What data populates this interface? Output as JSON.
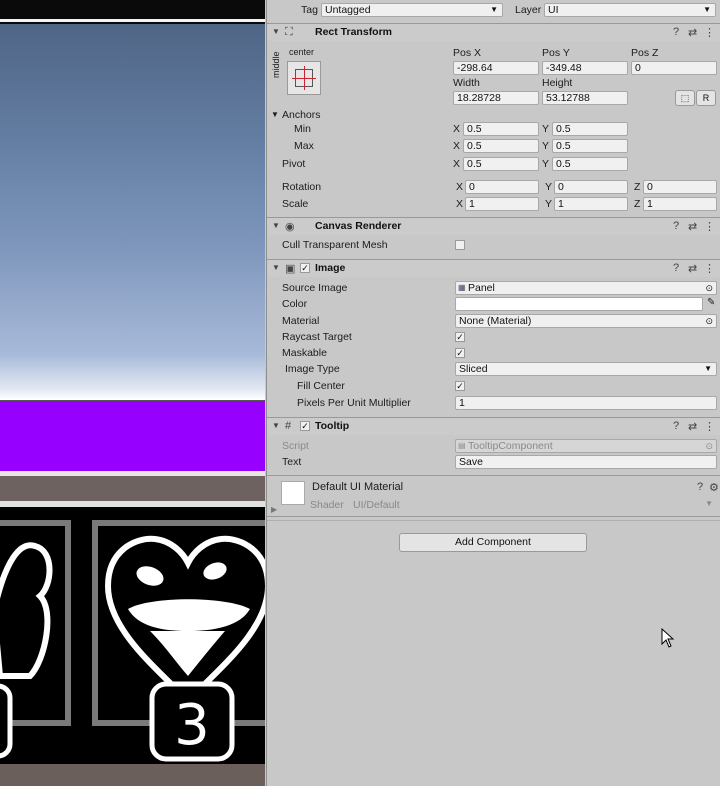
{
  "top": {
    "tag_label": "Tag",
    "tag_value": "Untagged",
    "layer_label": "Layer",
    "layer_value": "UI"
  },
  "rect_transform": {
    "title": "Rect Transform",
    "anchor_preset_top": "center",
    "anchor_preset_side": "middle",
    "pos_x_label": "Pos X",
    "pos_y_label": "Pos Y",
    "pos_z_label": "Pos Z",
    "pos_x": "-298.64",
    "pos_y": "-349.48",
    "pos_z": "0",
    "width_label": "Width",
    "height_label": "Height",
    "width": "18.28728",
    "height": "53.12788",
    "raw_edit_btn": "R",
    "anchors_label": "Anchors",
    "min_label": "Min",
    "max_label": "Max",
    "min_x": "0.5",
    "min_y": "0.5",
    "max_x": "0.5",
    "max_y": "0.5",
    "pivot_label": "Pivot",
    "pivot_x": "0.5",
    "pivot_y": "0.5",
    "rotation_label": "Rotation",
    "rot_x": "0",
    "rot_y": "0",
    "rot_z": "0",
    "scale_label": "Scale",
    "scale_x": "1",
    "scale_y": "1",
    "scale_z": "1",
    "axis_x": "X",
    "axis_y": "Y",
    "axis_z": "Z"
  },
  "canvas_renderer": {
    "title": "Canvas Renderer",
    "cull_label": "Cull Transparent Mesh"
  },
  "image": {
    "title": "Image",
    "source_image_label": "Source Image",
    "source_image_value": "Panel",
    "color_label": "Color",
    "material_label": "Material",
    "material_value": "None (Material)",
    "raycast_label": "Raycast Target",
    "maskable_label": "Maskable",
    "image_type_label": "Image Type",
    "image_type_value": "Sliced",
    "fill_center_label": "Fill Center",
    "ppu_label": "Pixels Per Unit Multiplier",
    "ppu_value": "1"
  },
  "tooltip": {
    "title": "Tooltip",
    "script_label": "Script",
    "script_value": "TooltipComponent",
    "text_label": "Text",
    "text_value": "Save"
  },
  "material_preview": {
    "title": "Default UI Material",
    "shader_label": "Shader",
    "shader_value": "UI/Default"
  },
  "add_component_label": "Add Component",
  "scene": {
    "level_number": "3"
  },
  "colors": {
    "purple_band": "#9500ff",
    "inspector_bg": "#c8c8c8"
  }
}
